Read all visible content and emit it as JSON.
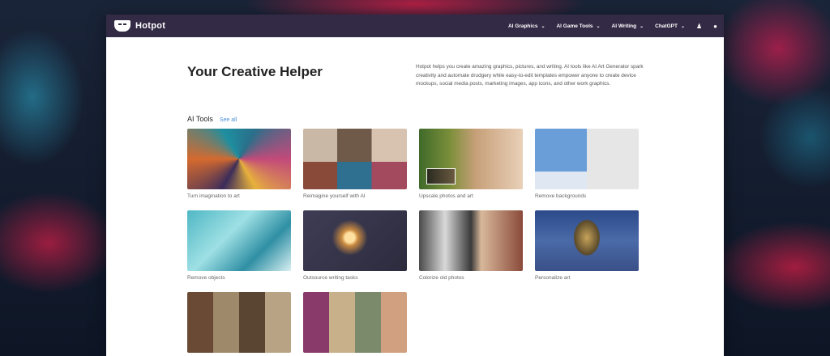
{
  "nav": {
    "brand": "Hotpot",
    "items": [
      {
        "label": "AI Graphics"
      },
      {
        "label": "AI Game Tools"
      },
      {
        "label": "AI Writing"
      },
      {
        "label": "ChatGPT"
      }
    ],
    "icons": [
      "user-icon",
      "chat-icon"
    ]
  },
  "hero": {
    "title": "Your Creative Helper",
    "description": "Hotpot helps you create amazing graphics, pictures, and writing. AI tools like AI Art Generator spark creativity and automate drudgery while easy-to-edit templates empower anyone to create device mockups, social media posts, marketing images, app icons, and other work graphics."
  },
  "tools": {
    "title": "AI Tools",
    "see_all": "See all",
    "cards": [
      {
        "caption": "Turn imagination to art"
      },
      {
        "caption": "Reimagine yourself with AI"
      },
      {
        "caption": "Upscale photos and art"
      },
      {
        "caption": "Remove backgrounds"
      },
      {
        "caption": "Remove objects"
      },
      {
        "caption": "Outsource writing tasks"
      },
      {
        "caption": "Colorize old photos"
      },
      {
        "caption": "Personalize art"
      },
      {
        "caption": ""
      },
      {
        "caption": ""
      }
    ]
  },
  "colors": {
    "navbar": "#332a45",
    "link": "#4a8fd8"
  }
}
